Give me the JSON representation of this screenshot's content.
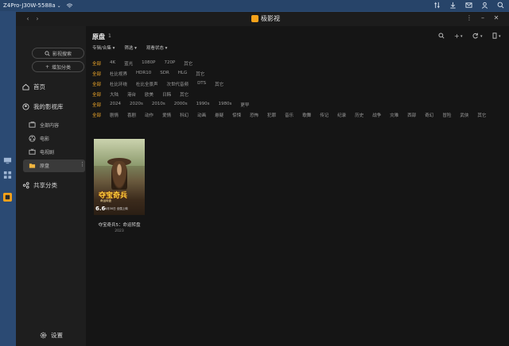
{
  "system": {
    "device_name": "Z4Pro-J30W-5588a",
    "dropdown_glyph": "⌄"
  },
  "app": {
    "name": "极影视",
    "accent": "#f6a21a",
    "nav_back": "‹",
    "nav_forward": "›"
  },
  "sidebar": {
    "search_button": "影视搜索",
    "add_category_button": "增加分类",
    "home": "首页",
    "my_library": "我的影视库",
    "sub_items": [
      {
        "label": "全部内容"
      },
      {
        "label": "电影"
      },
      {
        "label": "电视剧"
      },
      {
        "label": "原盘"
      }
    ],
    "more_glyph": "⋮",
    "shared": "共享分类",
    "settings": "设置"
  },
  "main": {
    "title": "原盘",
    "count": "1",
    "subtabs": [
      "专辑/合集",
      "筛选",
      "观看状态"
    ],
    "filter_rows": [
      [
        "全部",
        "4K",
        "蓝光",
        "1080P",
        "720P",
        "其它"
      ],
      [
        "全部",
        "杜比视界",
        "HDR10",
        "SDR",
        "HLG",
        "其它"
      ],
      [
        "全部",
        "杜比环绕",
        "杜比全景声",
        "次世代音频",
        "DTS",
        "其它"
      ],
      [
        "全部",
        "大陆",
        "港台",
        "欧美",
        "日韩",
        "其它"
      ],
      [
        "全部",
        "2024",
        "2020s",
        "2010s",
        "2000s",
        "1990s",
        "1980s",
        "更早"
      ],
      [
        "全部",
        "剧情",
        "喜剧",
        "动作",
        "爱情",
        "科幻",
        "动画",
        "悬疑",
        "惊悚",
        "恐怖",
        "犯罪",
        "音乐",
        "歌舞",
        "传记",
        "纪录",
        "历史",
        "战争",
        "灾难",
        "西部",
        "奇幻",
        "冒险",
        "武侠",
        "其它"
      ]
    ],
    "movie": {
      "title": "夺宝奇兵5：命运转盘",
      "year": "2023",
      "poster_title": "夺宝奇兵",
      "poster_subtitle": "命运转盘",
      "rating": "6.6",
      "release_text": "6月30日 全国上映"
    }
  }
}
